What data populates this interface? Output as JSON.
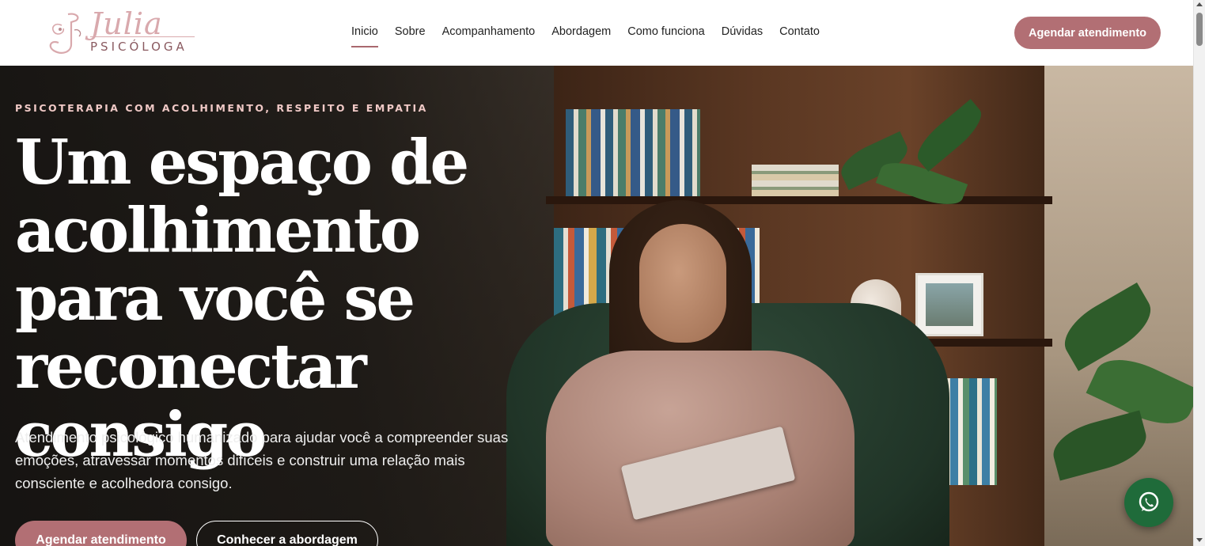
{
  "brand": {
    "name": "Julia",
    "subtitle": "PSICÓLOGA",
    "monogram": "J"
  },
  "nav": {
    "items": [
      {
        "label": "Inicio",
        "active": true
      },
      {
        "label": "Sobre",
        "active": false
      },
      {
        "label": "Acompanhamento",
        "active": false
      },
      {
        "label": "Abordagem",
        "active": false
      },
      {
        "label": "Como funciona",
        "active": false
      },
      {
        "label": "Dúvidas",
        "active": false
      },
      {
        "label": "Contato",
        "active": false
      }
    ],
    "cta_label": "Agendar atendimento"
  },
  "hero": {
    "eyebrow": "PSICOTERAPIA COM ACOLHIMENTO, RESPEITO E EMPATIA",
    "title": "Um espaço de acolhimento para você se reconectar consigo",
    "subtitle": "Atendimento psicológico humanizado para ajudar você a compreender suas emoções, atravessar momentos difíceis e construir uma relação mais consciente e acolhedora consigo.",
    "primary_button": "Agendar atendimento",
    "secondary_button": "Conhecer a abordagem"
  },
  "icons": {
    "whatsapp": "whatsapp-icon"
  },
  "colors": {
    "accent": "#b26f74",
    "logo": "#d9a9ad",
    "eyebrow": "#f0c9c6",
    "whatsapp": "#1f6b3a"
  }
}
